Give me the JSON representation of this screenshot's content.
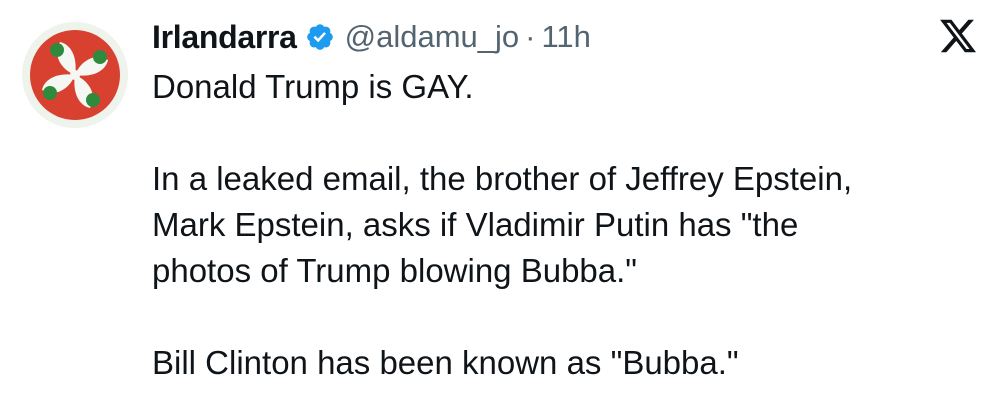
{
  "tweet": {
    "display_name": "Irlandarra",
    "handle": "@aldamu_jo",
    "separator": "·",
    "time": "11h",
    "verified": true,
    "lines": [
      "Donald Trump is GAY.",
      "",
      "In a leaked email, the brother of Jeffrey Epstein,",
      "Mark Epstein, asks if Vladimir Putin has \"the",
      "photos of Trump blowing Bubba.\"",
      "",
      "Bill Clinton has been known as \"Bubba.\""
    ]
  },
  "icons": {
    "avatar": "lauburu-avatar",
    "verified": "verified-badge-icon",
    "brand": "x-logo-icon"
  },
  "colors": {
    "text": "#0f1419",
    "secondary": "#536471",
    "verified": "#1d9bf0",
    "avatar_red": "#d8412f",
    "avatar_green": "#2e8b3e"
  }
}
